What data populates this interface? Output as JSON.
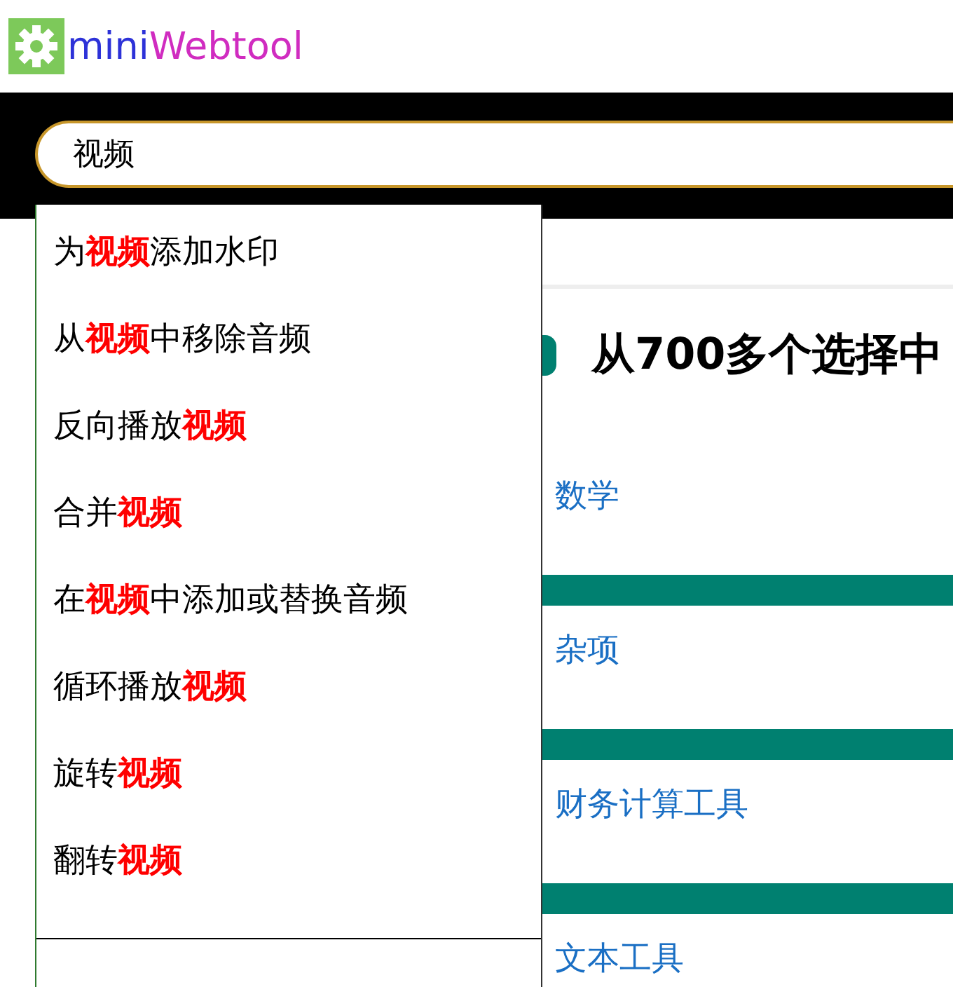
{
  "logo": {
    "part_1": "mini",
    "part_2": "Webtool"
  },
  "search": {
    "value": "视频"
  },
  "suggestions": [
    {
      "text": "为**视频**添加水印"
    },
    {
      "text": "从**视频**中移除音频"
    },
    {
      "text": "反向播放**视频**"
    },
    {
      "text": "合并**视频**"
    },
    {
      "text": "在**视频**中添加或替换音频"
    },
    {
      "text": "循环播放**视频**"
    },
    {
      "text": "旋转**视频**"
    },
    {
      "text": "翻转**视频**"
    }
  ],
  "heading": "从700多个选择中",
  "categories": [
    "数学",
    "杂项",
    "财务计算工具",
    "文本工具"
  ]
}
